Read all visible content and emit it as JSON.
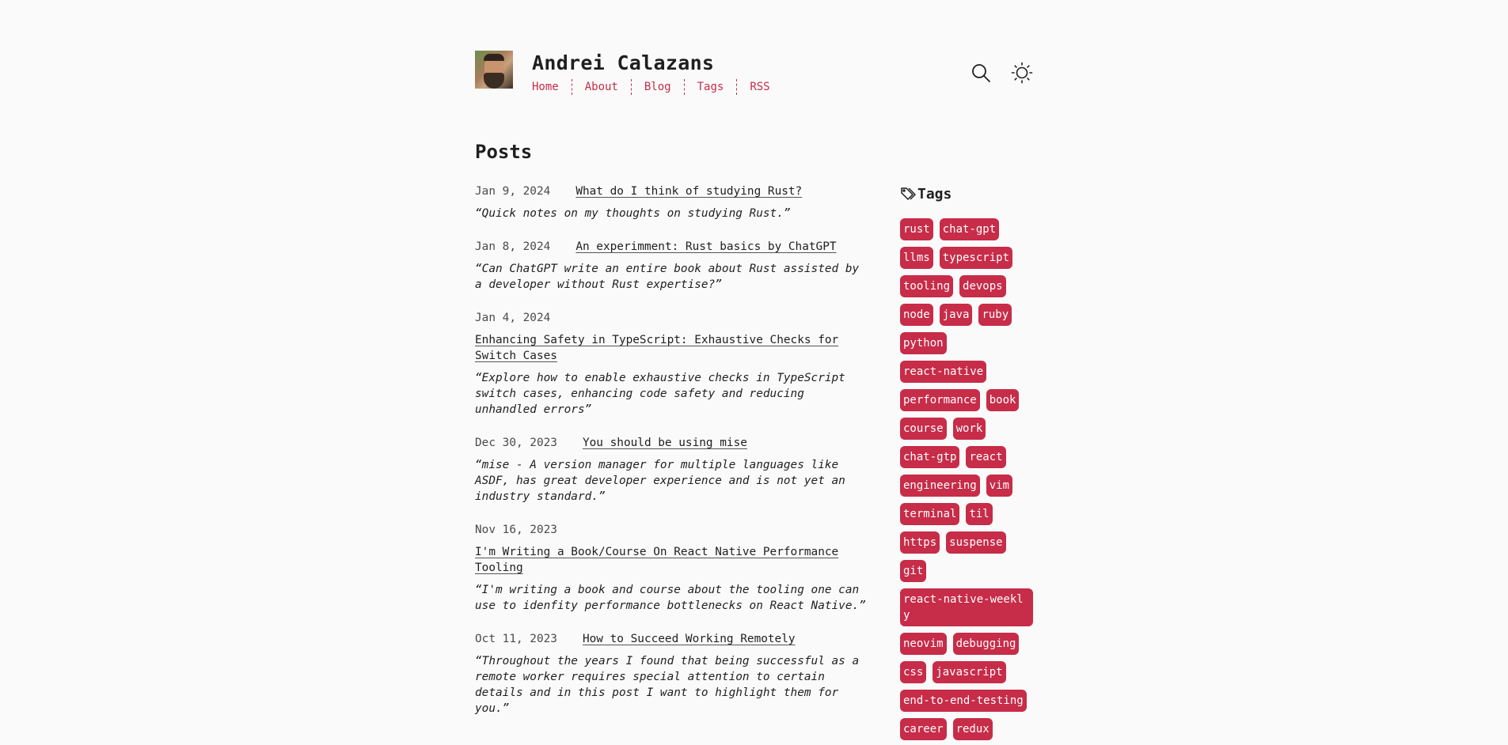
{
  "header": {
    "site_title": "Andrei Calazans",
    "nav": [
      "Home",
      "About",
      "Blog",
      "Tags",
      "RSS"
    ]
  },
  "posts_heading": "Posts",
  "posts": [
    {
      "date": "Jan 9, 2024",
      "title": "What do I think of studying Rust?",
      "desc": "“Quick notes on my thoughts on studying Rust.”"
    },
    {
      "date": "Jan 8, 2024",
      "title": "An experimment: Rust basics by ChatGPT",
      "desc": "“Can ChatGPT write an entire book about Rust assisted by a developer without Rust expertise?”"
    },
    {
      "date": "Jan 4, 2024",
      "title": "Enhancing Safety in TypeScript: Exhaustive Checks for Switch Cases",
      "desc": "“Explore how to enable exhaustive checks in TypeScript switch cases, enhancing code safety and reducing unhandled errors”"
    },
    {
      "date": "Dec 30, 2023",
      "title": "You should be using mise",
      "desc": "“mise - A version manager for multiple languages like ASDF, has great developer experience and is not yet an industry standard.”"
    },
    {
      "date": "Nov 16, 2023",
      "title": "I'm Writing a Book/Course On React Native Performance Tooling",
      "desc": "“I'm writing a book and course about the tooling one can use to idenfity performance bottlenecks on React Native.”"
    },
    {
      "date": "Oct 11, 2023",
      "title": "How to Succeed Working Remotely",
      "desc": "“Throughout the years I found that being successful as a remote worker requires special attention to certain details and in this post I want to highlight them for you.”"
    }
  ],
  "sidebar": {
    "title": "Tags",
    "tags": [
      "rust",
      "chat-gpt",
      "llms",
      "typescript",
      "tooling",
      "devops",
      "node",
      "java",
      "ruby",
      "python",
      "react-native",
      "performance",
      "book",
      "course",
      "work",
      "chat-gtp",
      "react",
      "engineering",
      "vim",
      "terminal",
      "til",
      "https",
      "suspense",
      "git",
      "react-native-weekly",
      "neovim",
      "debugging",
      "css",
      "javascript",
      "end-to-end-testing",
      "career",
      "redux"
    ]
  },
  "icons": {
    "search": "search-icon",
    "theme": "sun-icon",
    "tags": "tags-icon"
  },
  "colors": {
    "accent": "#c72c48",
    "background": "#fafafa",
    "text": "#1f1f1f"
  }
}
